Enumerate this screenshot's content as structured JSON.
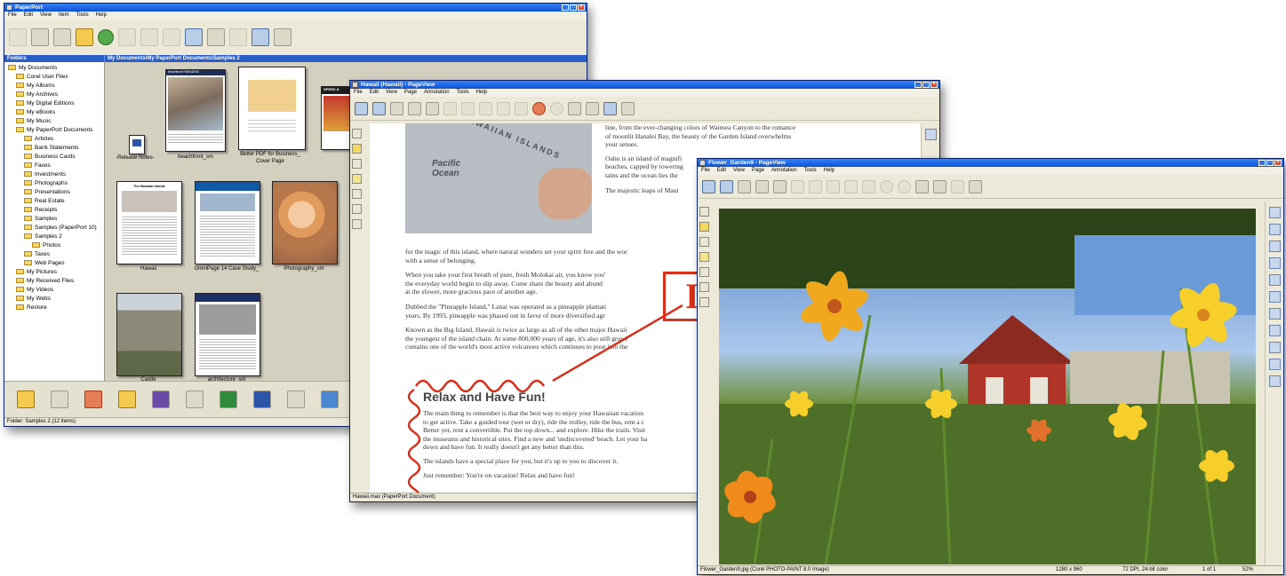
{
  "windows": {
    "paperport": {
      "title": "PaperPort",
      "menu": [
        "File",
        "Edit",
        "View",
        "Item",
        "Tools",
        "Help"
      ],
      "folders_header": "Folders",
      "path": "My Documents\\My PaperPort Documents\\Samples 2",
      "tree": [
        {
          "label": "My Documents",
          "level": 0
        },
        {
          "label": "Corel User Files",
          "level": 1
        },
        {
          "label": "My Albums",
          "level": 1
        },
        {
          "label": "My Archives",
          "level": 1
        },
        {
          "label": "My Digital Editions",
          "level": 1
        },
        {
          "label": "My eBooks",
          "level": 1
        },
        {
          "label": "My Music",
          "level": 1
        },
        {
          "label": "My PaperPort Documents",
          "level": 1
        },
        {
          "label": "Articles",
          "level": 2
        },
        {
          "label": "Bank Statements",
          "level": 2
        },
        {
          "label": "Business Cards",
          "level": 2
        },
        {
          "label": "Faxes",
          "level": 2
        },
        {
          "label": "Investments",
          "level": 2
        },
        {
          "label": "Photographs",
          "level": 2
        },
        {
          "label": "Presentations",
          "level": 2
        },
        {
          "label": "Real Estate",
          "level": 2
        },
        {
          "label": "Receipts",
          "level": 2
        },
        {
          "label": "Samples",
          "level": 2
        },
        {
          "label": "Samples (PaperPort 10)",
          "level": 2
        },
        {
          "label": "Samples 2",
          "level": 2
        },
        {
          "label": "Photos",
          "level": 3
        },
        {
          "label": "Taxes",
          "level": 2
        },
        {
          "label": "Web Pages",
          "level": 2
        },
        {
          "label": "My Pictures",
          "level": 1
        },
        {
          "label": "My Received Files",
          "level": 1
        },
        {
          "label": "My Videos",
          "level": 1
        },
        {
          "label": "My Webs",
          "level": 1
        },
        {
          "label": "Restore",
          "level": 1
        }
      ],
      "thumbs": {
        "release": "-Release Notes-",
        "beachfront": "beachfront_sm",
        "better_pdf_1": "Better PDF for Business_",
        "better_pdf_2": "Cover Page",
        "hawaii": "Hawaii",
        "omnipage": "OmniPage 14 Case Study_",
        "photography": "Photography_sm",
        "castle": "Castle",
        "architecture": "architecture_sm",
        "magazine_title": "beachfront PARADISE",
        "hawaiian_islands": "The Hawaiian Islands",
        "speed": "SPEED &"
      },
      "status": "Folder: Samples 2 (12 items)"
    },
    "hawaii": {
      "title": "Hawaii (Hawaii) - PageView",
      "menu": [
        "File",
        "Edit",
        "View",
        "Page",
        "Annotation",
        "Tools",
        "Help"
      ],
      "map_label_islands": "HAWAIIAN ISLANDS",
      "map_label_ocean_1": "Pacific",
      "map_label_ocean_2": "Ocean",
      "right_col": [
        "line, from the ever-changing colors of Waimea Canyon to the romance",
        "of moonlit Hanalei Bay, the beauty of the Garden Island overwhelms",
        "your senses.",
        "Oahu is an island of magnifi",
        "beaches, capped by towering",
        "tains and the ocean lies the",
        "The majestic leaps of Maui"
      ],
      "paragraphs": [
        "for the magic of this island, where natural wonders set your spirit free and the wor",
        "with a sense of belonging.",
        "When you take your first breath of pure, fresh Molokai air, you know you'",
        "the everyday world begin to slip away. Come share the beauty and abund",
        "at the slower, more gracious pace of another age.",
        "Dubbed the \"Pineapple Island,\" Lanai was operated as a pineapple plantati",
        "years. By 1993, pineapple was phased out in favor of more diversified agr",
        "Known as the Big Island, Hawaii is twice as large as all of the other major Hawaii",
        "the youngest of the island chain. At some 800,000 years of age, it's also still growi",
        "contains one of the world's most active volcanoes which continues to pour into the"
      ],
      "heading": "Relax and Have Fun!",
      "fun_paragraphs": [
        "The main thing to remember is that the best way to enjoy your Hawaiian vacation",
        "to get active. Take a guided tour (wet or dry), ride the trolley, ride the bus, rent a c",
        "Better yet, rent a convertible. Put the top down... and explore. Hike the trails. Visit",
        "the museums and historical sites. Find a new and 'undiscovered' beach. Let your ha",
        "down and have fun. It really doesn't get any better than this.",
        "The islands have a special place for you, but it's up to you to discover it.",
        "Just remember: You're on vacation! Relax and have fun!"
      ],
      "stamp": "IM",
      "status": "Hawaii.max (PaperPort Document)"
    },
    "flower": {
      "title": "Flower_Garden9 - PageView",
      "menu": [
        "File",
        "Edit",
        "View",
        "Page",
        "Annotation",
        "Tools",
        "Help"
      ],
      "status_name": "Flower_Garden9.jpg (Corel PHOTO-PAINT 8.0 Image)",
      "status_size": "1280 x 960",
      "status_dpi": "72 DPI, 24-bit color",
      "status_page": "1 of 1",
      "status_zoom": "52%"
    }
  },
  "colors": {
    "title_blue": "#0a54d7",
    "annotation_red": "#d8301a",
    "xp_face": "#ece9d8"
  }
}
